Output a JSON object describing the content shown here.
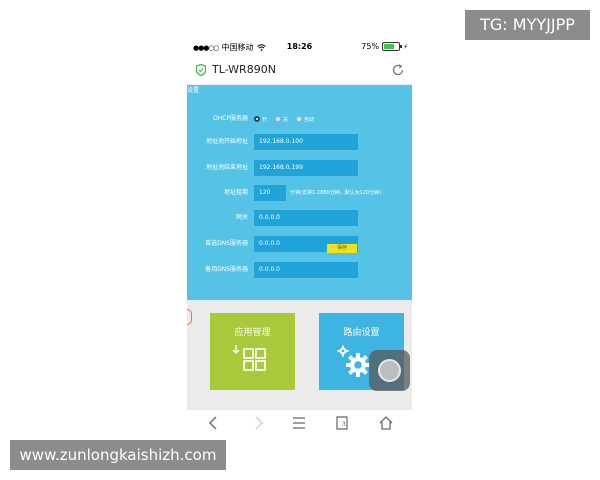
{
  "watermarks": {
    "top": "TG: MYYJJPP",
    "bottom": "www.zunlongkaishizh.com"
  },
  "status_bar": {
    "carrier": "中国移动",
    "time": "18:26",
    "battery": "75%",
    "battery_level": 0.75
  },
  "nav": {
    "title": "TL-WR890N"
  },
  "panel": {
    "crumb": "设置",
    "dhcp": {
      "label": "DHCP服务器",
      "options": [
        "开",
        "关",
        "自动"
      ],
      "selected": "开"
    },
    "fields": [
      {
        "label": "地址池开始地址",
        "value": "192.168.0.100"
      },
      {
        "label": "地址池结束地址",
        "value": "192.168.0.199"
      },
      {
        "label": "地址租期",
        "value": "120",
        "hint": "分钟(支持1-2880分钟，默认为120分钟)"
      },
      {
        "label": "网关",
        "value": "0.0.0.0"
      },
      {
        "label": "首选DNS服务器",
        "value": "0.0.0.0"
      },
      {
        "label": "备用DNS服务器",
        "value": "0.0.0.0"
      }
    ],
    "save_label": "保存"
  },
  "tiles": [
    {
      "label": "应用管理",
      "icon": "app-grid-icon"
    },
    {
      "label": "路由设置",
      "icon": "gear-icon"
    }
  ],
  "toolbar": [
    "back-icon",
    "forward-icon",
    "menu-icon",
    "tabs-icon",
    "home-icon"
  ],
  "toolbar_tab_count": "3",
  "colors": {
    "panel": "#54c3e6",
    "field": "#1fa3d8",
    "green_tile": "#a9c83a",
    "blue_tile": "#3eb4e2",
    "save": "#f2e21c"
  }
}
